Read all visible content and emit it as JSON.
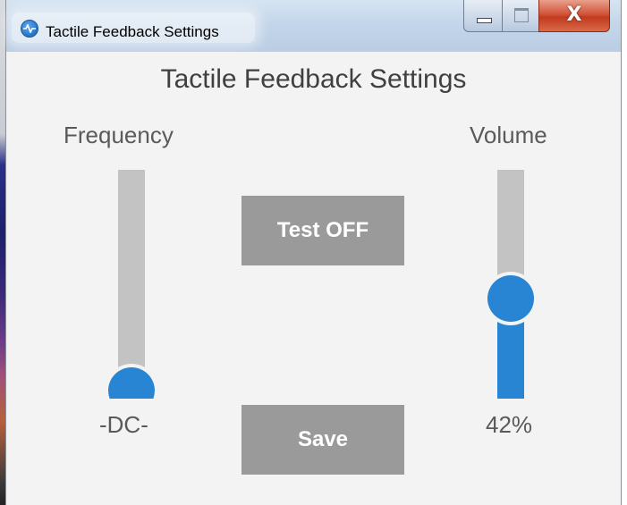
{
  "window": {
    "title": "Tactile Feedback Settings",
    "close_glyph": "X"
  },
  "content": {
    "heading": "Tactile Feedback Settings"
  },
  "frequency": {
    "label": "Frequency",
    "value_text": "-DC-",
    "slider_level": 0.0
  },
  "volume": {
    "label": "Volume",
    "value_text": "42%",
    "slider_level": 0.42
  },
  "buttons": {
    "test_label": "Test OFF",
    "save_label": "Save"
  },
  "colors": {
    "accent": "#2785d4",
    "track": "#c3c3c3",
    "button": "#9a9a9a",
    "background": "#f3f3f3"
  },
  "icons": {
    "app": "pulse-globe-icon",
    "minimize": "minimize-icon",
    "maximize": "maximize-icon",
    "close": "close-icon"
  }
}
